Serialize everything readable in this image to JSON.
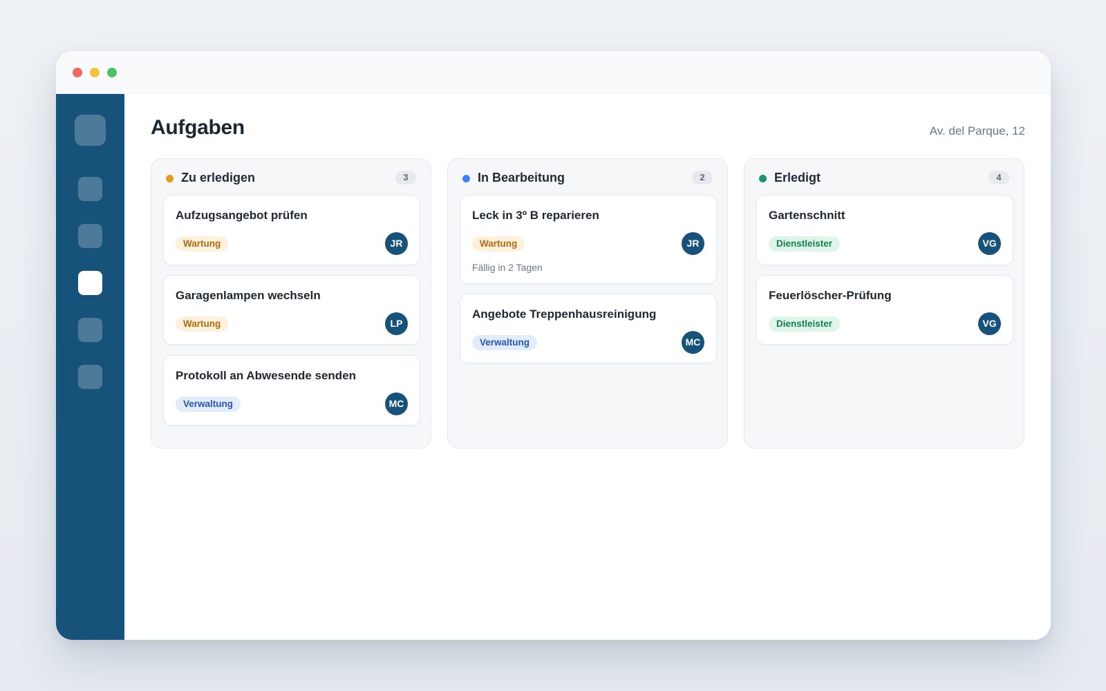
{
  "page": {
    "title": "Aufgaben",
    "address": "Av. del Parque, 12"
  },
  "sidebar": {
    "active_index": 2,
    "items": [
      "nav-item",
      "nav-item",
      "nav-item",
      "nav-item",
      "nav-item"
    ]
  },
  "colors": {
    "sidebar": "#17527a",
    "todo": "#e39b1b",
    "in_progress": "#3b82f6",
    "done": "#16966a"
  },
  "columns": [
    {
      "title": "Zu erledigen",
      "count": "3",
      "cards": [
        {
          "title": "Aufzugsangebot prüfen",
          "tag": "Wartung",
          "assignee": "JR"
        },
        {
          "title": "Garagenlampen wechseln",
          "tag": "Wartung",
          "assignee": "LP"
        },
        {
          "title": "Protokoll an Abwesende senden",
          "tag": "Verwaltung",
          "assignee": "MC"
        }
      ]
    },
    {
      "title": "In Bearbeitung",
      "count": "2",
      "cards": [
        {
          "title": "Leck in 3º B reparieren",
          "tag": "Wartung",
          "assignee": "JR",
          "due": "Fällig in 2 Tagen"
        },
        {
          "title": "Angebote Treppenhausreinigung",
          "tag": "Verwaltung",
          "assignee": "MC"
        }
      ]
    },
    {
      "title": "Erledigt",
      "count": "4",
      "cards": [
        {
          "title": "Gartenschnitt",
          "tag": "Dienstleister",
          "assignee": "VG"
        },
        {
          "title": "Feuerlöscher-Prüfung",
          "tag": "Dienstleister",
          "assignee": "VG"
        }
      ]
    }
  ]
}
